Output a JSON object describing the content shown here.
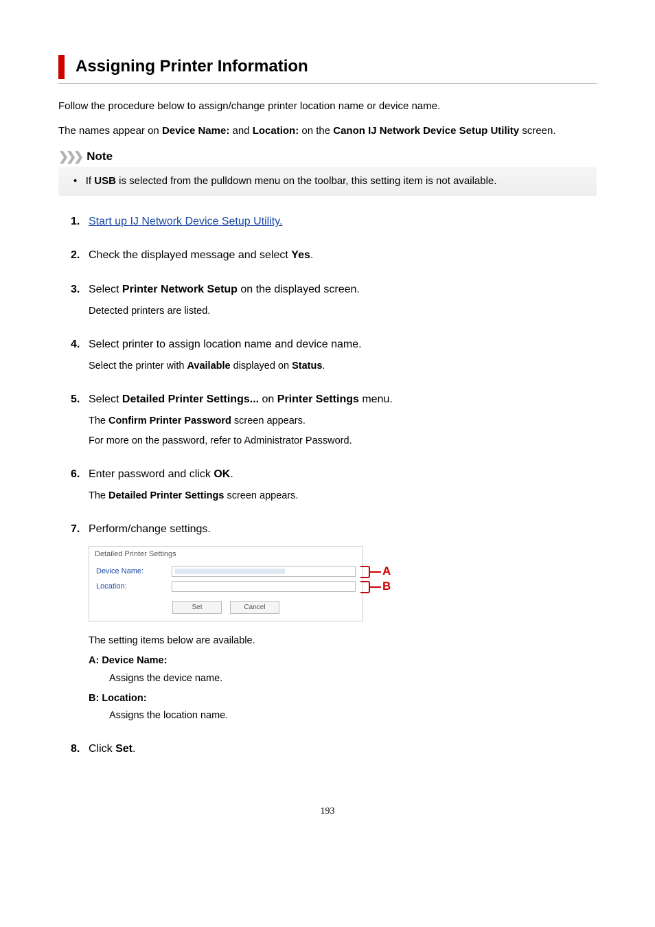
{
  "title": "Assigning Printer Information",
  "intro1": "Follow the procedure below to assign/change printer location name or device name.",
  "intro2_a": "The names appear on ",
  "intro2_b": "Device Name:",
  "intro2_c": " and ",
  "intro2_d": "Location:",
  "intro2_e": " on the ",
  "intro2_f": "Canon IJ Network Device Setup Utility",
  "intro2_g": " screen.",
  "note": {
    "label": "Note",
    "text_a": "If ",
    "text_b": "USB",
    "text_c": " is selected from the pulldown menu on the toolbar, this setting item is not available."
  },
  "steps": {
    "s1": {
      "num": "1.",
      "link": "Start up IJ Network Device Setup Utility."
    },
    "s2": {
      "num": "2.",
      "a": "Check the displayed message and select ",
      "b": "Yes",
      "c": "."
    },
    "s3": {
      "num": "3.",
      "a": "Select ",
      "b": "Printer Network Setup",
      "c": " on the displayed screen.",
      "body": "Detected printers are listed."
    },
    "s4": {
      "num": "4.",
      "a": "Select printer to assign location name and device name.",
      "body_a": "Select the printer with ",
      "body_b": "Available",
      "body_c": " displayed on ",
      "body_d": "Status",
      "body_e": "."
    },
    "s5": {
      "num": "5.",
      "a": "Select ",
      "b": "Detailed Printer Settings...",
      "c": " on ",
      "d": "Printer Settings",
      "e": " menu.",
      "body1_a": "The ",
      "body1_b": "Confirm Printer Password",
      "body1_c": " screen appears.",
      "body2": "For more on the password, refer to Administrator Password."
    },
    "s6": {
      "num": "6.",
      "a": "Enter password and click ",
      "b": "OK",
      "c": ".",
      "body_a": "The ",
      "body_b": "Detailed Printer Settings",
      "body_c": " screen appears."
    },
    "s7": {
      "num": "7.",
      "a": "Perform/change settings.",
      "dialog": {
        "title": "Detailed Printer Settings",
        "device_label": "Device Name:",
        "location_label": "Location:",
        "set_btn": "Set",
        "cancel_btn": "Cancel"
      },
      "annot_a": "A",
      "annot_b": "B",
      "desc_intro": "The setting items below are available.",
      "item_a_head": "A: Device Name:",
      "item_a_body": "Assigns the device name.",
      "item_b_head": "B: Location:",
      "item_b_body": "Assigns the location name."
    },
    "s8": {
      "num": "8.",
      "a": "Click ",
      "b": "Set",
      "c": "."
    }
  },
  "page_number": "193"
}
